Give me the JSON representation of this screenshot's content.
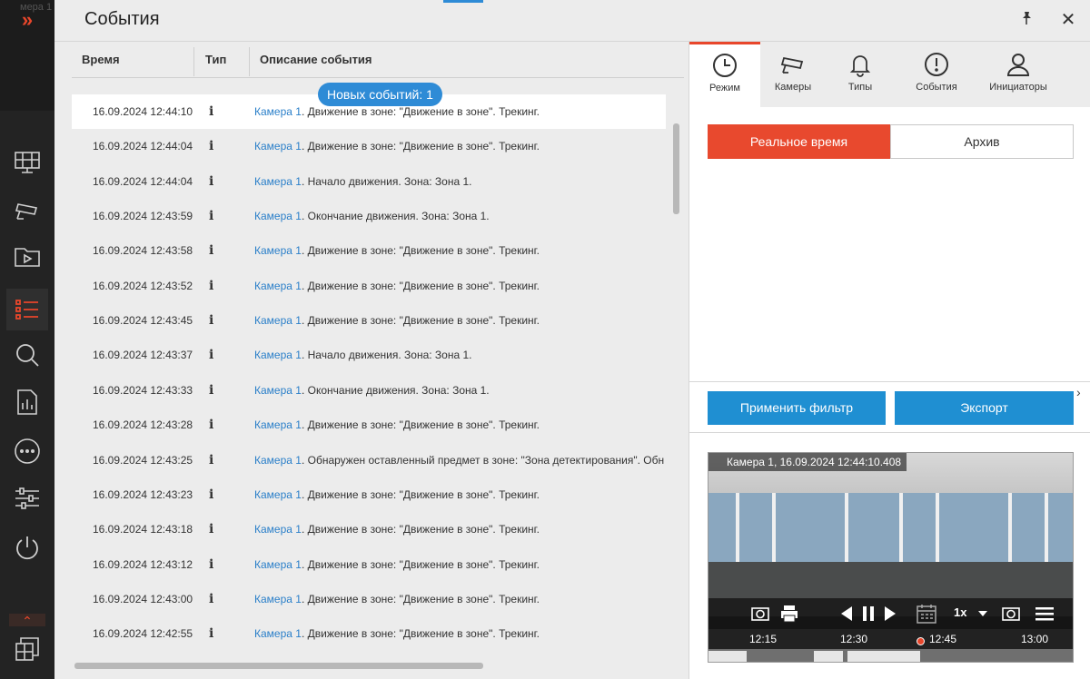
{
  "sidebar": {
    "camera_hint": "мера 1",
    "expand_label": "»",
    "up_label": "⌃",
    "items": [
      {
        "icon": "monitor-grid-icon",
        "active": false
      },
      {
        "icon": "camera-icon",
        "active": false
      },
      {
        "icon": "video-folder-icon",
        "active": false
      },
      {
        "icon": "events-list-icon",
        "active": true
      },
      {
        "icon": "search-icon",
        "active": false
      },
      {
        "icon": "report-icon",
        "active": false
      },
      {
        "icon": "more-icon",
        "active": false
      },
      {
        "icon": "settings-sliders-icon",
        "active": false
      },
      {
        "icon": "power-icon",
        "active": false
      }
    ],
    "layout_icon": "layouts-icon",
    "accent_color": "#e8462b"
  },
  "header": {
    "title": "События",
    "pin_icon": "pin-icon",
    "close_label": "✕"
  },
  "table": {
    "columns": [
      "Время",
      "Тип",
      "Описание события"
    ],
    "badge": "Новых событий: 1",
    "type_glyph": "i",
    "rows": [
      {
        "time": "16.09.2024 12:44:10",
        "camera": "Камера 1",
        "text": ". Движение в зоне: \"Движение в зоне\". Трекинг.",
        "selected": true
      },
      {
        "time": "16.09.2024 12:44:04",
        "camera": "Камера 1",
        "text": ". Движение в зоне: \"Движение в зоне\". Трекинг."
      },
      {
        "time": "16.09.2024 12:44:04",
        "camera": "Камера 1",
        "text": ". Начало движения. Зона: Зона 1."
      },
      {
        "time": "16.09.2024 12:43:59",
        "camera": "Камера 1",
        "text": ". Окончание движения. Зона: Зона 1."
      },
      {
        "time": "16.09.2024 12:43:58",
        "camera": "Камера 1",
        "text": ". Движение в зоне: \"Движение в зоне\". Трекинг."
      },
      {
        "time": "16.09.2024 12:43:52",
        "camera": "Камера 1",
        "text": ". Движение в зоне: \"Движение в зоне\". Трекинг."
      },
      {
        "time": "16.09.2024 12:43:45",
        "camera": "Камера 1",
        "text": ". Движение в зоне: \"Движение в зоне\". Трекинг."
      },
      {
        "time": "16.09.2024 12:43:37",
        "camera": "Камера 1",
        "text": ". Начало движения. Зона: Зона 1."
      },
      {
        "time": "16.09.2024 12:43:33",
        "camera": "Камера 1",
        "text": ". Окончание движения. Зона: Зона 1."
      },
      {
        "time": "16.09.2024 12:43:28",
        "camera": "Камера 1",
        "text": ". Движение в зоне: \"Движение в зоне\". Трекинг."
      },
      {
        "time": "16.09.2024 12:43:25",
        "camera": "Камера 1",
        "text": ". Обнаружен оставленный предмет в зоне: \"Зона детектирования\". Обн"
      },
      {
        "time": "16.09.2024 12:43:23",
        "camera": "Камера 1",
        "text": ". Движение в зоне: \"Движение в зоне\". Трекинг."
      },
      {
        "time": "16.09.2024 12:43:18",
        "camera": "Камера 1",
        "text": ". Движение в зоне: \"Движение в зоне\". Трекинг."
      },
      {
        "time": "16.09.2024 12:43:12",
        "camera": "Камера 1",
        "text": ". Движение в зоне: \"Движение в зоне\". Трекинг."
      },
      {
        "time": "16.09.2024 12:43:00",
        "camera": "Камера 1",
        "text": ". Движение в зоне: \"Движение в зоне\". Трекинг."
      },
      {
        "time": "16.09.2024 12:42:55",
        "camera": "Камера 1",
        "text": ". Движение в зоне: \"Движение в зоне\". Трекинг."
      }
    ]
  },
  "filters": {
    "tabs": [
      {
        "label": "Режим",
        "icon": "clock-icon",
        "active": true
      },
      {
        "label": "Камеры",
        "icon": "camera-icon",
        "active": false
      },
      {
        "label": "Типы",
        "icon": "bell-icon",
        "active": false
      },
      {
        "label": "События",
        "icon": "alert-icon",
        "active": false
      },
      {
        "label": "Инициаторы",
        "icon": "user-icon",
        "active": false
      }
    ],
    "mode_realtime": "Реальное время",
    "mode_archive": "Архив",
    "apply_label": "Применить фильтр",
    "export_label": "Экспорт",
    "more_label": "›"
  },
  "viewer": {
    "caption": "Камера 1, 16.09.2024 12:44:10.408",
    "speed": "1x",
    "ticks": [
      "12:15",
      "12:30",
      "12:45",
      "13:00"
    ],
    "icons": [
      "snapshot-icon",
      "print-icon",
      "prev-frame-icon",
      "pause-icon",
      "next-frame-icon",
      "calendar-icon",
      "speed-dropdown-icon",
      "export-frame-icon",
      "menu-icon"
    ]
  }
}
